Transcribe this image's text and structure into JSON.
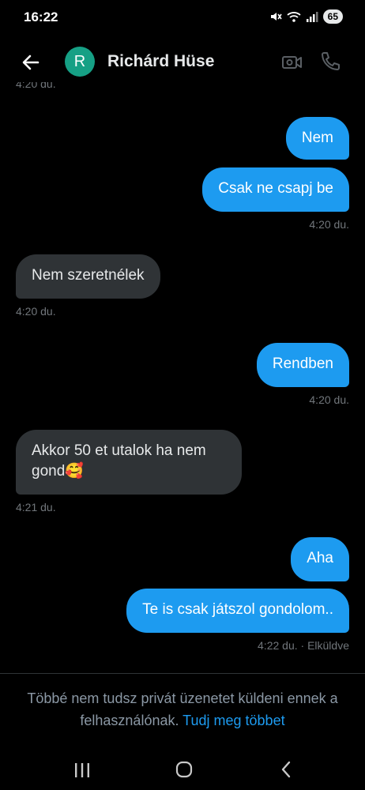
{
  "status_bar": {
    "time": "16:22",
    "battery": "65"
  },
  "header": {
    "avatar_letter": "R",
    "contact_name": "Richárd Hüse"
  },
  "messages": [
    {
      "text": "4:20 du."
    },
    {
      "text": "Nem"
    },
    {
      "text": "Csak ne csapj be"
    },
    {
      "text": "4:20 du."
    },
    {
      "text": "Nem szeretnélek"
    },
    {
      "text": "4:20 du."
    },
    {
      "text": "Rendben"
    },
    {
      "text": "4:20 du."
    },
    {
      "text": "Akkor 50 et utalok ha nem gond🥰"
    },
    {
      "text": "4:21 du."
    },
    {
      "text": "Aha"
    },
    {
      "text": "Te is csak játszol gondolom.."
    },
    {
      "text": "4:22 du. · Elküldve"
    }
  ],
  "notice": {
    "text": "Többé nem tudsz privát üzenetet küldeni ennek a felhasználónak.",
    "link": "Tudj meg többet"
  },
  "colors": {
    "background": "#000000",
    "sent_bubble": "#1d9bf0",
    "received_bubble": "#2f3336",
    "avatar": "#16a085"
  }
}
